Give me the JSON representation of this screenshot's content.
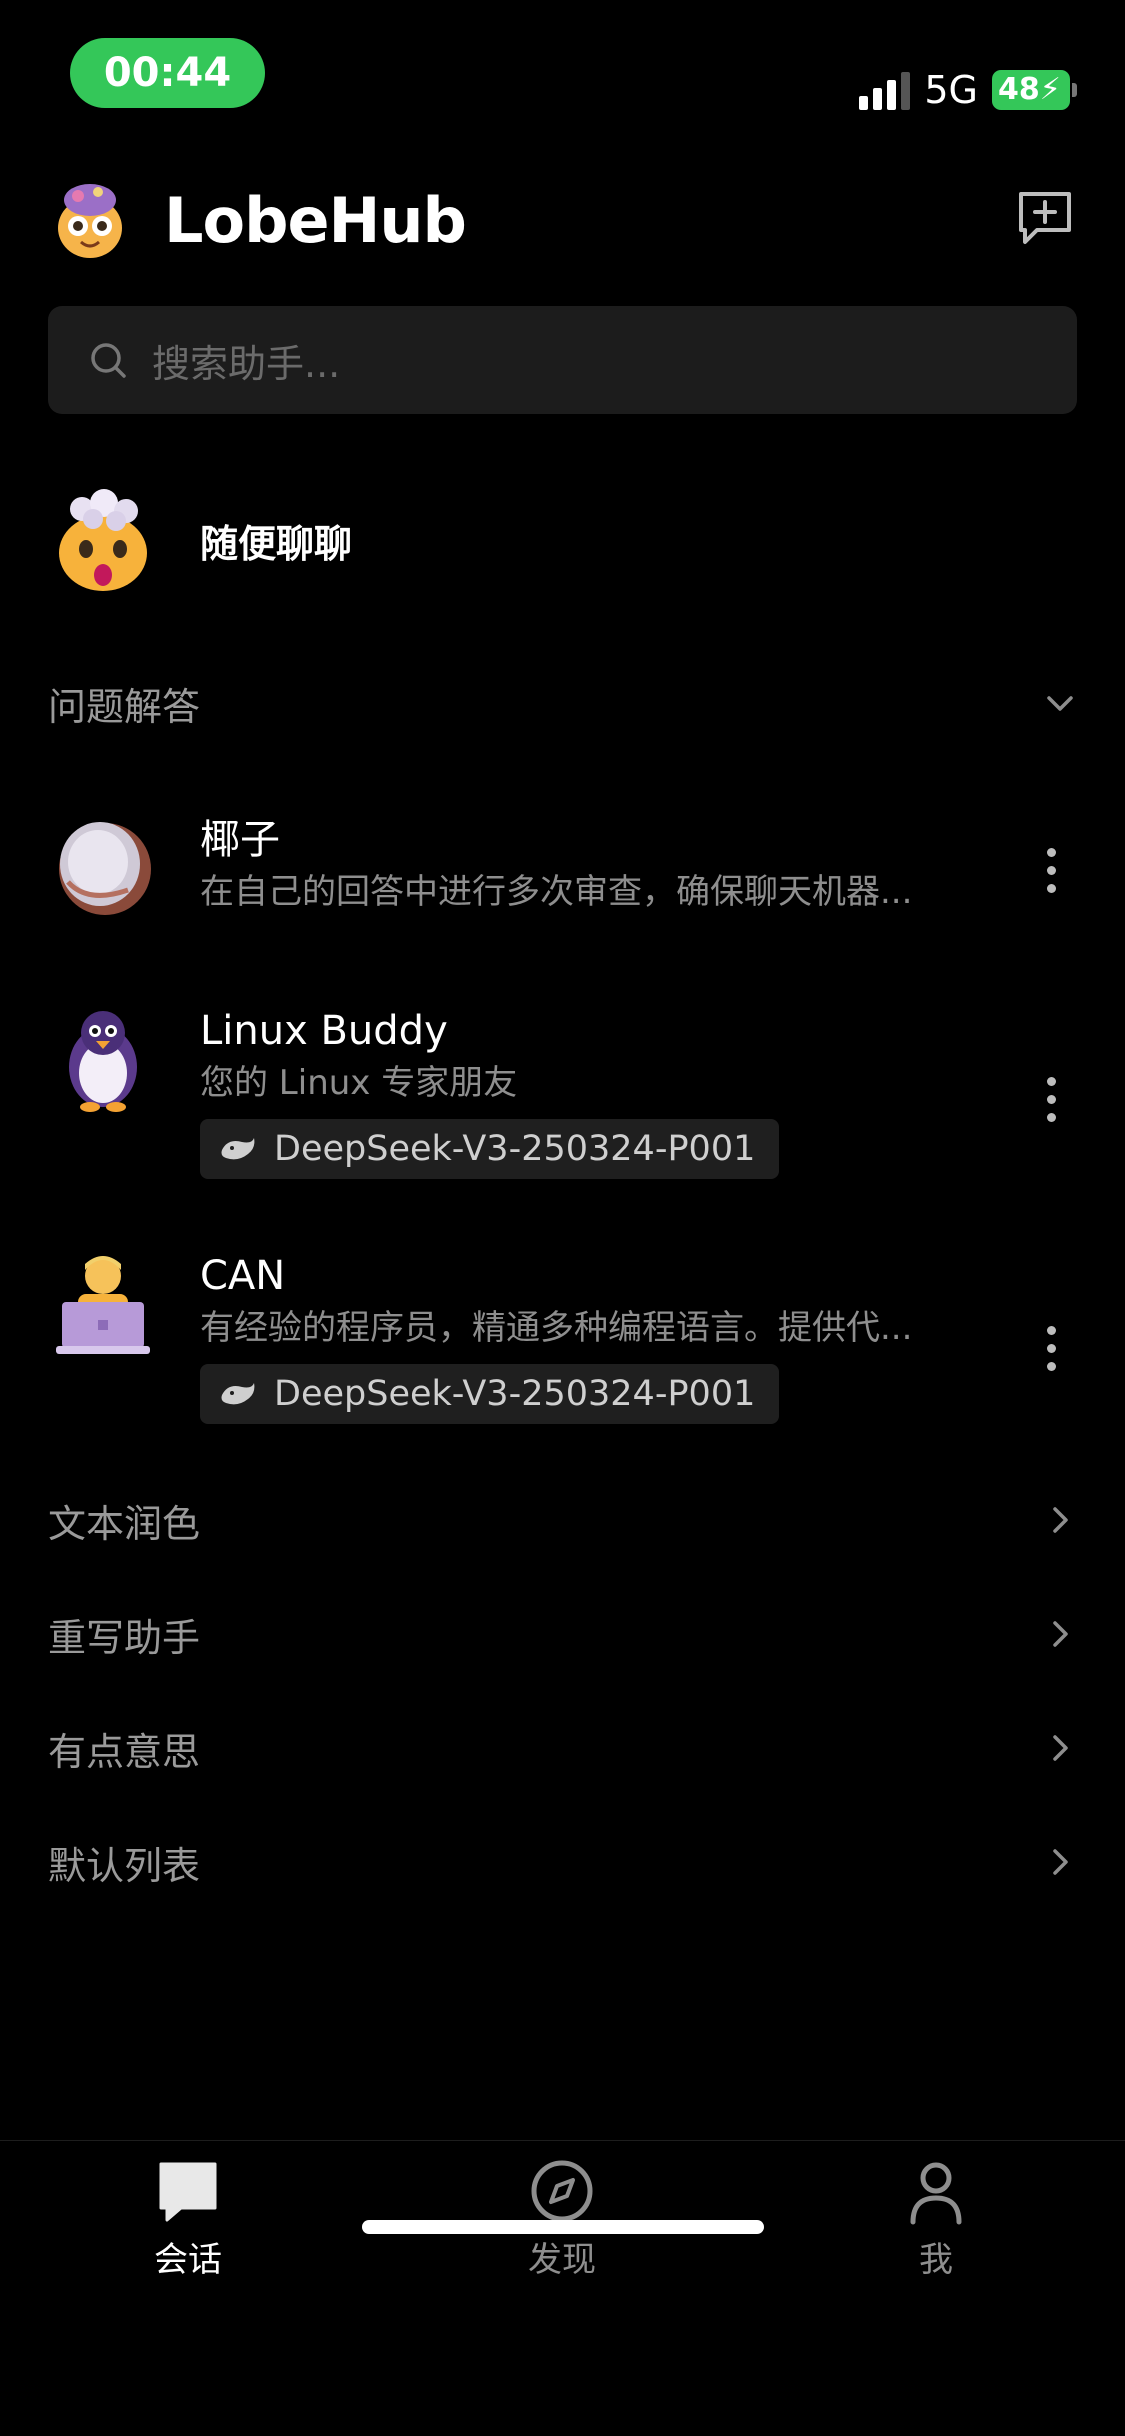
{
  "status_bar": {
    "time": "00:44",
    "network": "5G",
    "battery": "48"
  },
  "header": {
    "title": "LobeHub"
  },
  "search": {
    "placeholder": "搜索助手..."
  },
  "random_chat": {
    "label": "随便聊聊"
  },
  "groups": [
    {
      "title": "问题解答",
      "expanded": true,
      "agents": [
        {
          "name": "椰子",
          "description": "在自己的回答中进行多次审查，确保聊天机器...",
          "model": ""
        },
        {
          "name": "Linux Buddy",
          "description": "您的 Linux 专家朋友",
          "model": "DeepSeek-V3-250324-P001"
        },
        {
          "name": "CAN",
          "description": "有经验的程序员，精通多种编程语言。提供代...",
          "model": "DeepSeek-V3-250324-P001"
        }
      ]
    },
    {
      "title": "文本润色",
      "expanded": false
    },
    {
      "title": "重写助手",
      "expanded": false
    },
    {
      "title": "有点意思",
      "expanded": false
    },
    {
      "title": "默认列表",
      "expanded": false
    }
  ],
  "tabs": [
    {
      "label": "会话",
      "icon": "chat-bubble-icon",
      "active": true
    },
    {
      "label": "发现",
      "icon": "compass-icon",
      "active": false
    },
    {
      "label": "我",
      "icon": "person-icon",
      "active": false
    }
  ],
  "colors": {
    "accent_green": "#34c759",
    "background": "#000000",
    "muted_text": "#8e8e8e"
  }
}
